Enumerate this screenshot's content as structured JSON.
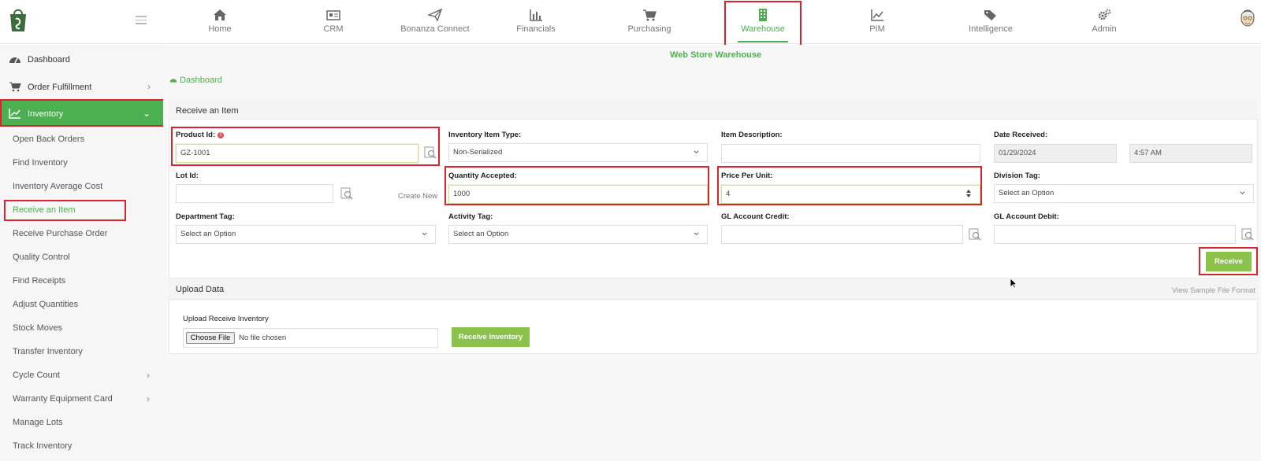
{
  "nav": {
    "items": [
      {
        "label": "Home",
        "icon": "home-icon"
      },
      {
        "label": "CRM",
        "icon": "crm-icon"
      },
      {
        "label": "Bonanza Connect",
        "icon": "paper-plane-icon"
      },
      {
        "label": "Financials",
        "icon": "bar-chart-icon"
      },
      {
        "label": "Purchasing",
        "icon": "cart-icon"
      },
      {
        "label": "Warehouse",
        "icon": "building-icon"
      },
      {
        "label": "PIM",
        "icon": "line-chart-icon"
      },
      {
        "label": "Intelligence",
        "icon": "tags-icon"
      },
      {
        "label": "Admin",
        "icon": "cogs-icon"
      }
    ],
    "active": "Warehouse",
    "accent": "#4caf50"
  },
  "sidebar": {
    "top": [
      {
        "label": "Dashboard",
        "icon": "dashboard-icon"
      },
      {
        "label": "Order Fulfillment",
        "icon": "cart-icon"
      },
      {
        "label": "Inventory",
        "icon": "line-chart-icon"
      }
    ],
    "sub": [
      "Open Back Orders",
      "Find Inventory",
      "Inventory Average Cost",
      "Receive an Item",
      "Receive Purchase Order",
      "Quality Control",
      "Find Receipts",
      "Adjust Quantities",
      "Stock Moves",
      "Transfer Inventory",
      "Cycle Count",
      "Warranty Equipment Card",
      "Manage Lots",
      "Track Inventory"
    ],
    "active_sub": "Receive an Item"
  },
  "header": {
    "store": "Web Store Warehouse",
    "breadcrumb": "Dashboard"
  },
  "form": {
    "title": "Receive an Item",
    "product_id": {
      "label": "Product Id:",
      "value": "GZ-1001"
    },
    "item_type": {
      "label": "Inventory Item Type:",
      "value": "Non-Serialized"
    },
    "item_description": {
      "label": "Item Description:",
      "value": ""
    },
    "date_received": {
      "label": "Date Received:",
      "date": "01/29/2024",
      "time": "4:57 AM"
    },
    "lot_id": {
      "label": "Lot Id:",
      "value": "",
      "create_new": "Create New"
    },
    "quantity": {
      "label": "Quantity Accepted:",
      "value": "1000"
    },
    "price": {
      "label": "Price Per Unit:",
      "value": "4"
    },
    "division": {
      "label": "Division Tag:",
      "placeholder": "Select an Option"
    },
    "department": {
      "label": "Department Tag:",
      "placeholder": "Select an Option"
    },
    "activity": {
      "label": "Activity Tag:",
      "placeholder": "Select an Option"
    },
    "gl_credit": {
      "label": "GL Account Credit:",
      "value": ""
    },
    "gl_debit": {
      "label": "GL Account Debit:",
      "value": ""
    },
    "receive_button": "Receive"
  },
  "upload": {
    "title": "Upload Data",
    "sample_link": "View Sample File Format",
    "label": "Upload Receive Inventory",
    "choose_file": "Choose File",
    "no_file": "No file chosen",
    "button": "Receive Inventory"
  }
}
